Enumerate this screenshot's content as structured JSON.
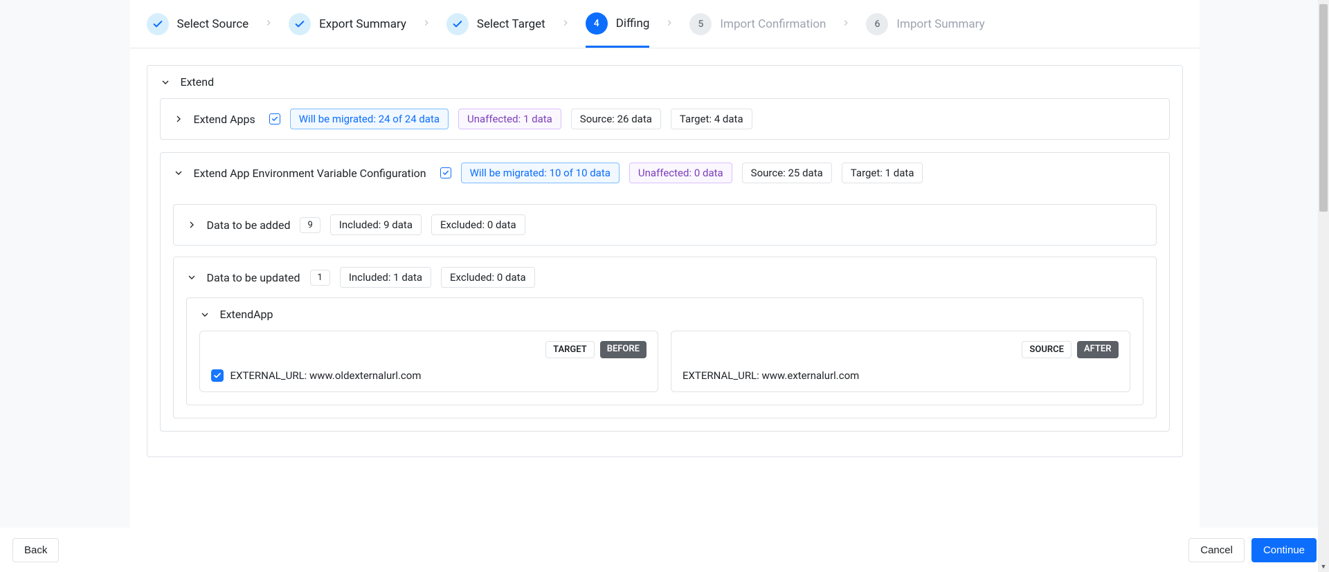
{
  "stepper": {
    "steps": [
      {
        "label": "Select Source",
        "state": "done"
      },
      {
        "label": "Export Summary",
        "state": "done"
      },
      {
        "label": "Select Target",
        "state": "done"
      },
      {
        "num": "4",
        "label": "Diffing",
        "state": "current"
      },
      {
        "num": "5",
        "label": "Import Confirmation",
        "state": "upcoming"
      },
      {
        "num": "6",
        "label": "Import Summary",
        "state": "upcoming"
      }
    ]
  },
  "extend": {
    "title": "Extend",
    "apps": {
      "title": "Extend Apps",
      "migrated_label": "Will be migrated:",
      "migrated_value": "24 of 24 data",
      "unaffected_label": "Unaffected:",
      "unaffected_value": "1 data",
      "source": "Source: 26 data",
      "target": "Target: 4 data"
    },
    "env": {
      "title": "Extend App Environment Variable Configuration",
      "migrated_label": "Will be migrated:",
      "migrated_value": "10 of 10 data",
      "unaffected_label": "Unaffected:",
      "unaffected_value": "0 data",
      "source": "Source: 25 data",
      "target": "Target: 1 data",
      "added": {
        "title": "Data to be added",
        "count": "9",
        "included": "Included: 9 data",
        "excluded": "Excluded: 0 data"
      },
      "updated": {
        "title": "Data to be updated",
        "count": "1",
        "included": "Included: 1 data",
        "excluded": "Excluded: 0 data",
        "group": "ExtendApp",
        "target_label": "TARGET",
        "before_label": "BEFORE",
        "source_label": "SOURCE",
        "after_label": "AFTER",
        "left_text": "EXTERNAL_URL: www.oldexternalurl.com",
        "right_text": "EXTERNAL_URL: www.externalurl.com"
      }
    }
  },
  "footer": {
    "back": "Back",
    "cancel": "Cancel",
    "continue": "Continue"
  }
}
